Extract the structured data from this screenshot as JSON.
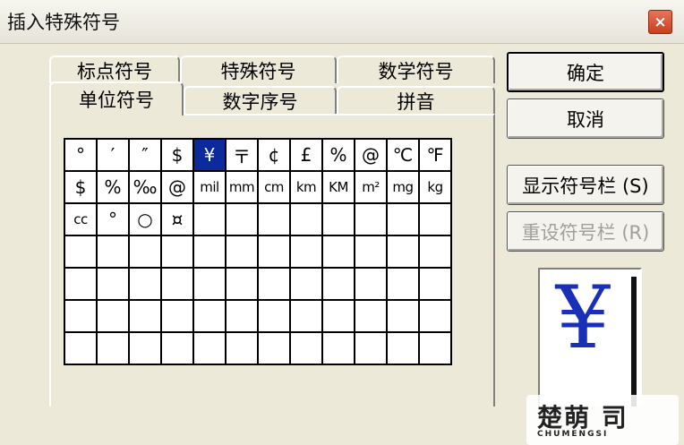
{
  "window": {
    "title": "插入特殊符号",
    "close_label": "×"
  },
  "tabs": {
    "row1": [
      "标点符号",
      "特殊符号",
      "数学符号"
    ],
    "row2": [
      "单位符号",
      "数字序号",
      "拼音"
    ],
    "active": "单位符号"
  },
  "symbol_grid": {
    "rows": [
      [
        "°",
        "′",
        "″",
        "$",
        "¥",
        "〒",
        "¢",
        "£",
        "%",
        "@",
        "℃",
        "℉"
      ],
      [
        "$",
        "%",
        "‰",
        "@",
        "mil",
        "mm",
        "cm",
        "km",
        "KM",
        "m²",
        "mg",
        "kg"
      ],
      [
        "cc",
        "°",
        "○",
        "¤",
        "",
        "",
        "",
        "",
        "",
        "",
        "",
        ""
      ],
      [
        "",
        "",
        "",
        "",
        "",
        "",
        "",
        "",
        "",
        "",
        "",
        ""
      ],
      [
        "",
        "",
        "",
        "",
        "",
        "",
        "",
        "",
        "",
        "",
        "",
        ""
      ],
      [
        "",
        "",
        "",
        "",
        "",
        "",
        "",
        "",
        "",
        "",
        "",
        ""
      ],
      [
        "",
        "",
        "",
        "",
        "",
        "",
        "",
        "",
        "",
        "",
        "",
        ""
      ]
    ],
    "selected": "¥"
  },
  "buttons": {
    "ok": "确定",
    "cancel": "取消",
    "show_toolbar": "显示符号栏 (S)",
    "reset_toolbar": "重设符号栏 (R)"
  },
  "preview": {
    "char": "¥"
  },
  "watermark": {
    "logo": "楚萌 司",
    "sub": "CHUMENGSI"
  },
  "colors": {
    "selection": "#0b2a9c",
    "preview_char": "#1a2fb8",
    "dialog_bg": "#ece9d8"
  }
}
